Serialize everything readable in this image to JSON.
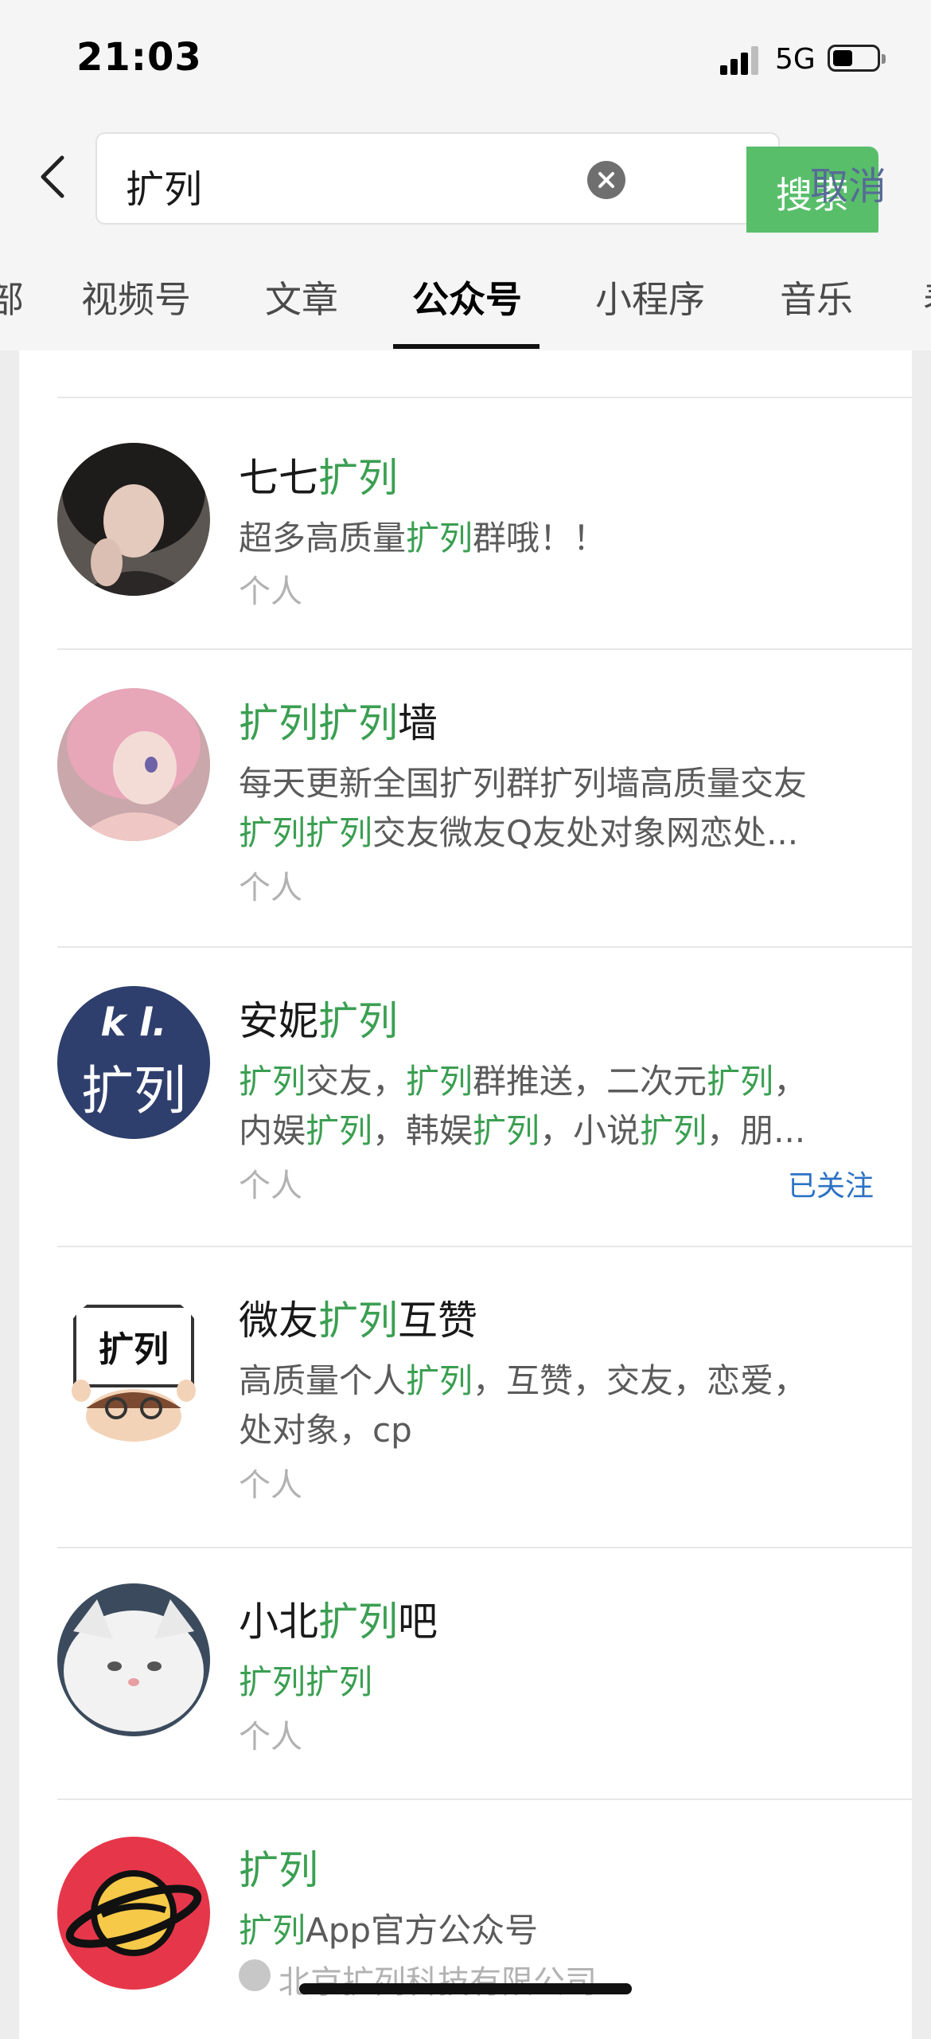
{
  "status": {
    "time": "21:03",
    "network": "5G"
  },
  "search": {
    "query": "扩列",
    "search_button": "搜索",
    "cancel": "取消"
  },
  "tabs": [
    {
      "label": "部"
    },
    {
      "label": "视频号"
    },
    {
      "label": "文章"
    },
    {
      "label": "公众号",
      "active": true
    },
    {
      "label": "小程序"
    },
    {
      "label": "音乐"
    },
    {
      "label": "表"
    }
  ],
  "results": [
    {
      "title": [
        "七七",
        "扩列"
      ],
      "desc": [
        "超多高质量",
        "扩列",
        "群哦！！"
      ],
      "type": "个人"
    },
    {
      "title": [
        "扩列扩列",
        "墙"
      ],
      "desc1": "每天更新全国扩列群扩列墙高质量交友",
      "desc2": [
        "扩列扩列",
        "交友微友Q友处对象网恋处..."
      ],
      "type": "个人"
    },
    {
      "title": [
        "安妮",
        "扩列"
      ],
      "desc1": [
        "扩列",
        "交友，",
        "扩列",
        "群推送，二次元",
        "扩列",
        "，"
      ],
      "desc2": [
        "内娱",
        "扩列",
        "，韩娱",
        "扩列",
        "，小说",
        "扩列",
        "，朋..."
      ],
      "type": "个人",
      "followed": "已关注",
      "avatar_text_top": "k l.",
      "avatar_text_bottom": "扩列"
    },
    {
      "title": [
        "微友",
        "扩列",
        "互赞"
      ],
      "desc1": [
        "高质量个人",
        "扩列",
        "，互赞，交友，恋爱，"
      ],
      "desc2": "处对象，cp",
      "type": "个人",
      "avatar_text": "扩列"
    },
    {
      "title": [
        "小北",
        "扩列",
        "吧"
      ],
      "desc": "扩列扩列",
      "type": "个人"
    },
    {
      "title": "扩列",
      "desc": [
        "扩列",
        "App官方公众号"
      ],
      "company": "北京扩列科技有限公司"
    }
  ],
  "colors": {
    "highlight": "#3b9f52",
    "search_button": "#58be6a",
    "link": "#576b95",
    "followed": "#2d72c4"
  }
}
